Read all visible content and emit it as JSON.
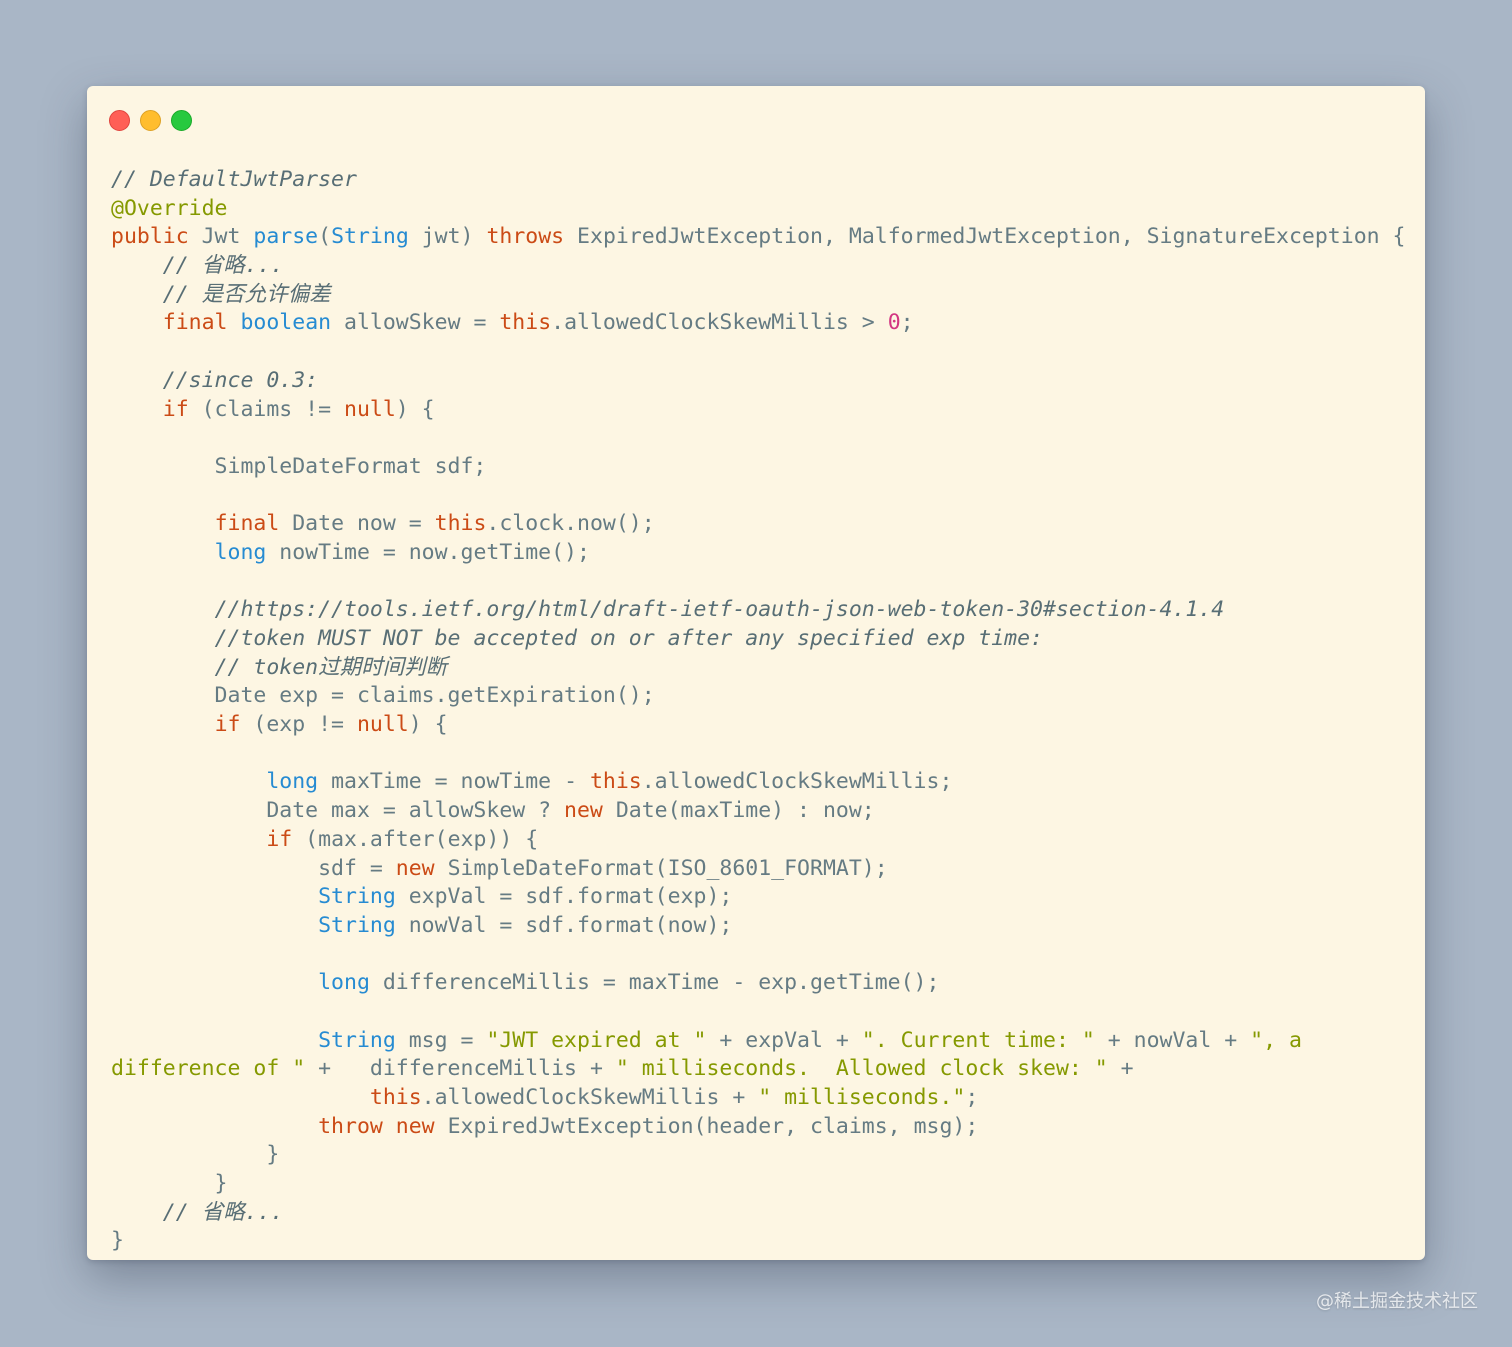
{
  "window": {
    "controls": [
      {
        "name": "close",
        "color": "#ff5f56"
      },
      {
        "name": "minimize",
        "color": "#ffbd2e"
      },
      {
        "name": "zoom",
        "color": "#27c93f"
      }
    ]
  },
  "colors": {
    "background": "#a9b6c6",
    "editor_background": "#fdf6e3",
    "comment": "#586e75",
    "keyword": "#cb4b16",
    "type": "#268bd2",
    "string": "#859900",
    "number": "#d33682"
  },
  "code": {
    "language": "java",
    "lines": [
      [
        {
          "t": "comment",
          "v": "// DefaultJwtParser"
        }
      ],
      [
        {
          "t": "annotation",
          "v": "@Override"
        }
      ],
      [
        {
          "t": "keyword",
          "v": "public"
        },
        {
          "t": "plain",
          "v": " Jwt "
        },
        {
          "t": "func",
          "v": "parse"
        },
        {
          "t": "plain",
          "v": "("
        },
        {
          "t": "type",
          "v": "String"
        },
        {
          "t": "plain",
          "v": " jwt) "
        },
        {
          "t": "keyword",
          "v": "throws"
        },
        {
          "t": "plain",
          "v": " ExpiredJwtException, MalformedJwtException, SignatureException {"
        }
      ],
      [
        {
          "t": "plain",
          "v": "    "
        },
        {
          "t": "comment",
          "v": "// 省略..."
        }
      ],
      [
        {
          "t": "plain",
          "v": "    "
        },
        {
          "t": "comment",
          "v": "// 是否允许偏差"
        }
      ],
      [
        {
          "t": "plain",
          "v": "    "
        },
        {
          "t": "keyword",
          "v": "final"
        },
        {
          "t": "plain",
          "v": " "
        },
        {
          "t": "type",
          "v": "boolean"
        },
        {
          "t": "plain",
          "v": " allowSkew = "
        },
        {
          "t": "keyword",
          "v": "this"
        },
        {
          "t": "plain",
          "v": ".allowedClockSkewMillis > "
        },
        {
          "t": "number",
          "v": "0"
        },
        {
          "t": "plain",
          "v": ";"
        }
      ],
      [],
      [
        {
          "t": "plain",
          "v": "    "
        },
        {
          "t": "comment",
          "v": "//since 0.3:"
        }
      ],
      [
        {
          "t": "plain",
          "v": "    "
        },
        {
          "t": "keyword",
          "v": "if"
        },
        {
          "t": "plain",
          "v": " (claims != "
        },
        {
          "t": "keyword",
          "v": "null"
        },
        {
          "t": "plain",
          "v": ") {"
        }
      ],
      [],
      [
        {
          "t": "plain",
          "v": "        SimpleDateFormat sdf;"
        }
      ],
      [],
      [
        {
          "t": "plain",
          "v": "        "
        },
        {
          "t": "keyword",
          "v": "final"
        },
        {
          "t": "plain",
          "v": " Date now = "
        },
        {
          "t": "keyword",
          "v": "this"
        },
        {
          "t": "plain",
          "v": ".clock.now();"
        }
      ],
      [
        {
          "t": "plain",
          "v": "        "
        },
        {
          "t": "type",
          "v": "long"
        },
        {
          "t": "plain",
          "v": " nowTime = now.getTime();"
        }
      ],
      [],
      [
        {
          "t": "plain",
          "v": "        "
        },
        {
          "t": "comment",
          "v": "//https://tools.ietf.org/html/draft-ietf-oauth-json-web-token-30#section-4.1.4"
        }
      ],
      [
        {
          "t": "plain",
          "v": "        "
        },
        {
          "t": "comment",
          "v": "//token MUST NOT be accepted on or after any specified exp time:"
        }
      ],
      [
        {
          "t": "plain",
          "v": "        "
        },
        {
          "t": "comment",
          "v": "// token过期时间判断"
        }
      ],
      [
        {
          "t": "plain",
          "v": "        Date exp = claims.getExpiration();"
        }
      ],
      [
        {
          "t": "plain",
          "v": "        "
        },
        {
          "t": "keyword",
          "v": "if"
        },
        {
          "t": "plain",
          "v": " (exp != "
        },
        {
          "t": "keyword",
          "v": "null"
        },
        {
          "t": "plain",
          "v": ") {"
        }
      ],
      [],
      [
        {
          "t": "plain",
          "v": "            "
        },
        {
          "t": "type",
          "v": "long"
        },
        {
          "t": "plain",
          "v": " maxTime = nowTime - "
        },
        {
          "t": "keyword",
          "v": "this"
        },
        {
          "t": "plain",
          "v": ".allowedClockSkewMillis;"
        }
      ],
      [
        {
          "t": "plain",
          "v": "            Date max = allowSkew ? "
        },
        {
          "t": "keyword",
          "v": "new"
        },
        {
          "t": "plain",
          "v": " Date(maxTime) : now;"
        }
      ],
      [
        {
          "t": "plain",
          "v": "            "
        },
        {
          "t": "keyword",
          "v": "if"
        },
        {
          "t": "plain",
          "v": " (max.after(exp)) {"
        }
      ],
      [
        {
          "t": "plain",
          "v": "                sdf = "
        },
        {
          "t": "keyword",
          "v": "new"
        },
        {
          "t": "plain",
          "v": " SimpleDateFormat(ISO_8601_FORMAT);"
        }
      ],
      [
        {
          "t": "plain",
          "v": "                "
        },
        {
          "t": "type",
          "v": "String"
        },
        {
          "t": "plain",
          "v": " expVal = sdf.format(exp);"
        }
      ],
      [
        {
          "t": "plain",
          "v": "                "
        },
        {
          "t": "type",
          "v": "String"
        },
        {
          "t": "plain",
          "v": " nowVal = sdf.format(now);"
        }
      ],
      [],
      [
        {
          "t": "plain",
          "v": "                "
        },
        {
          "t": "type",
          "v": "long"
        },
        {
          "t": "plain",
          "v": " differenceMillis = maxTime - exp.getTime();"
        }
      ],
      [],
      [
        {
          "t": "plain",
          "v": "                "
        },
        {
          "t": "type",
          "v": "String"
        },
        {
          "t": "plain",
          "v": " msg = "
        },
        {
          "t": "string",
          "v": "\"JWT expired at \""
        },
        {
          "t": "plain",
          "v": " + expVal + "
        },
        {
          "t": "string",
          "v": "\". Current time: \""
        },
        {
          "t": "plain",
          "v": " + nowVal + "
        },
        {
          "t": "string",
          "v": "\", a"
        }
      ],
      [
        {
          "t": "string",
          "v": "difference of \""
        },
        {
          "t": "plain",
          "v": " +   differenceMillis + "
        },
        {
          "t": "string",
          "v": "\" milliseconds.  Allowed clock skew: \""
        },
        {
          "t": "plain",
          "v": " +"
        }
      ],
      [
        {
          "t": "plain",
          "v": "                    "
        },
        {
          "t": "keyword",
          "v": "this"
        },
        {
          "t": "plain",
          "v": ".allowedClockSkewMillis + "
        },
        {
          "t": "string",
          "v": "\" milliseconds.\""
        },
        {
          "t": "plain",
          "v": ";"
        }
      ],
      [
        {
          "t": "plain",
          "v": "                "
        },
        {
          "t": "keyword",
          "v": "throw"
        },
        {
          "t": "plain",
          "v": " "
        },
        {
          "t": "keyword",
          "v": "new"
        },
        {
          "t": "plain",
          "v": " ExpiredJwtException(header, claims, msg);"
        }
      ],
      [
        {
          "t": "plain",
          "v": "            }"
        }
      ],
      [
        {
          "t": "plain",
          "v": "        }"
        }
      ],
      [
        {
          "t": "plain",
          "v": "    "
        },
        {
          "t": "comment",
          "v": "// 省略..."
        }
      ],
      [
        {
          "t": "plain",
          "v": "}"
        }
      ]
    ]
  },
  "watermark": "@稀土掘金技术社区"
}
